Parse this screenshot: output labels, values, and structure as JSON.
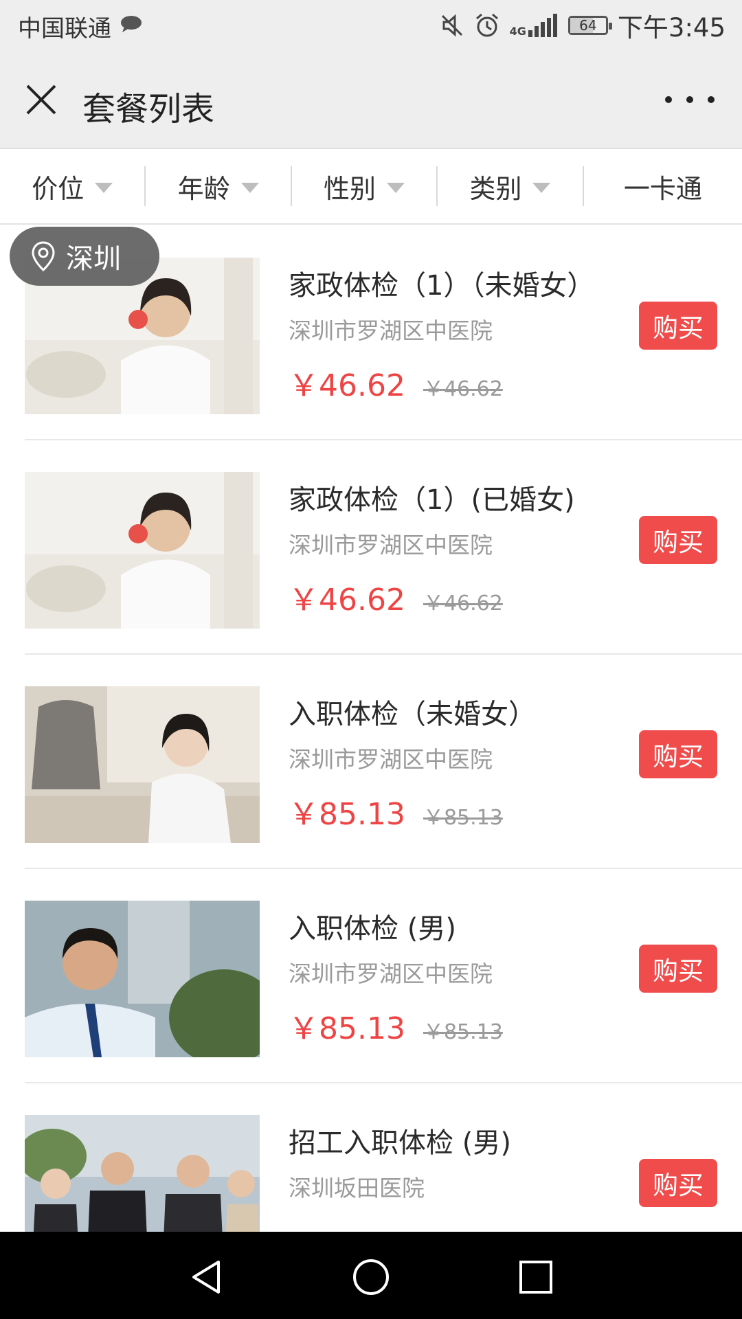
{
  "status_bar": {
    "carrier": "中国联通",
    "network": "4G",
    "battery_level": "64",
    "battery_fraction": 0.64,
    "time": "下午3:45"
  },
  "nav": {
    "title": "套餐列表"
  },
  "filters": {
    "price": "价位",
    "age": "年龄",
    "gender": "性别",
    "category": "类别",
    "card": "一卡通"
  },
  "location": "深圳",
  "packages": [
    {
      "title": "家政体检（1）（未婚女）",
      "hospital": "深圳市罗湖区中医院",
      "price": "￥46.62",
      "old_price": "￥46.62",
      "buy_label": "购买"
    },
    {
      "title": "家政体检（1）(已婚女)",
      "hospital": "深圳市罗湖区中医院",
      "price": "￥46.62",
      "old_price": "￥46.62",
      "buy_label": "购买"
    },
    {
      "title": "入职体检（未婚女）",
      "hospital": "深圳市罗湖区中医院",
      "price": "￥85.13",
      "old_price": "￥85.13",
      "buy_label": "购买"
    },
    {
      "title": "入职体检 (男)",
      "hospital": "深圳市罗湖区中医院",
      "price": "￥85.13",
      "old_price": "￥85.13",
      "buy_label": "购买"
    },
    {
      "title": "招工入职体检 (男)",
      "hospital": "深圳坂田医院",
      "price": "",
      "old_price": "",
      "buy_label": "购买"
    }
  ],
  "colors": {
    "accent": "#f04c4c",
    "price": "#ee4444",
    "header_bg": "#eeeeee"
  }
}
